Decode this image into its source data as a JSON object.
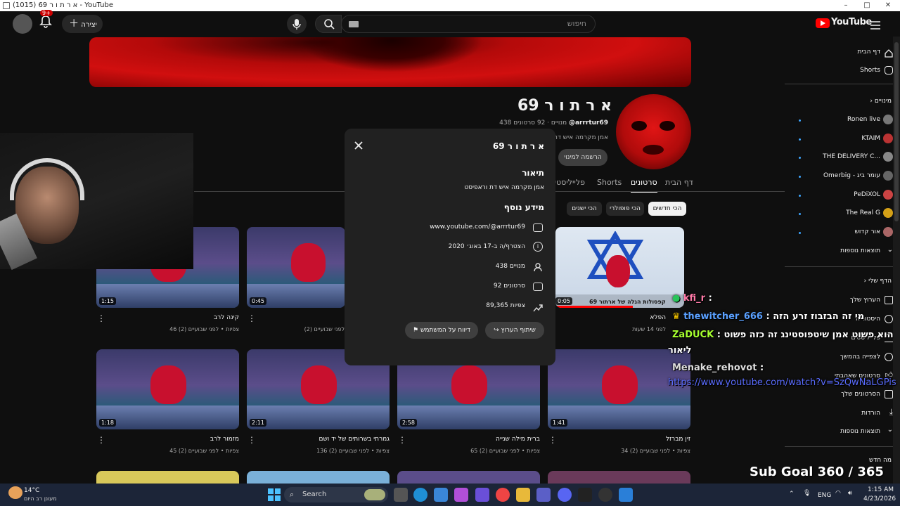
{
  "window": {
    "title": "(1015) א ר ת ו ר 69 - YouTube",
    "minimize": "–",
    "maximize": "□",
    "close": "✕"
  },
  "topbar": {
    "create_label": "יצירה",
    "notif_count": "9+",
    "search_placeholder": "חיפוש",
    "logo_text": "YouTube"
  },
  "channel": {
    "name": "א ר ת ו ר 69",
    "handle": "@arrrtur69",
    "meta": "438 מנויים · 92 סרטונים",
    "desc": "אמן מקרמה איש דת וראפיסט",
    "subscribe_label": "הרשמה למינוי"
  },
  "tabs": [
    "דף הבית",
    "סרטונים",
    "Shorts",
    "פלייליסטים"
  ],
  "chips": [
    "הכי חדשים",
    "הכי פופולרי",
    "הכי ישנים"
  ],
  "videos_row1": [
    {
      "dur": "1:15",
      "title": "קינה לרב",
      "meta": "46 צפיות • לפני שבועיים (2)"
    },
    {
      "dur": "0:45",
      "title": "",
      "meta": "לפני שבועיים (2)"
    },
    {
      "dur": "0:05",
      "title": "הפלא",
      "meta": "לפני 14 שעות",
      "overlay": "קפסולות הגלה של ארתור 69"
    }
  ],
  "videos_row2": [
    {
      "dur": "1:18",
      "title": "מזמור לרב",
      "meta": "45 צפיות • לפני שבועיים (2)"
    },
    {
      "dur": "2:11",
      "title": "גמרתי בשרותים של יד ושם",
      "meta": "136 צפיות • לפני שבועיים (2)"
    },
    {
      "dur": "2:58",
      "title": "ברית מילה שנייה",
      "meta": "65 צפיות • לפני שבועיים (2)"
    },
    {
      "dur": "1:41",
      "title": "זין מברזל",
      "meta": "34 צפיות • לפני שבועיים (2)"
    }
  ],
  "modal": {
    "title": "א ר ת ו ר 69",
    "about_heading": "תיאור",
    "about_text": "אמן מקרמה איש דת וראפיסט",
    "more_heading": "מידע נוסף",
    "url": "www.youtube.com/@arrrtur69",
    "joined": "הצטרף/ה ב-17 באוג׳ 2020",
    "subs": "438 מנויים",
    "videos": "92 סרטונים",
    "views": "89,365 צפיות",
    "share_label": "שיתוף הערוץ",
    "report_label": "דיווח על המשתמש"
  },
  "sidebar": {
    "home": "דף הבית",
    "shorts": "Shorts",
    "subs_heading": "מינויים",
    "subs": [
      "Ronen live",
      "KTAIM",
      "THE DELIVERY C...",
      "Omerbig - עומר ביג",
      "PeDiXOL",
      "The Real G",
      "אור קדוש"
    ],
    "show_more": "תוצאות נוספות",
    "you_heading": "הדף שלי",
    "you_items": [
      "הערוץ שלך",
      "היסטוריה",
      "פלייליסטים",
      "לצפייה בהמשך",
      "סרטונים שאהבתי",
      "הסרטונים שלך",
      "הורדות",
      "תוצאות נוספות"
    ],
    "new_heading": "מה חדש"
  },
  "chat": [
    {
      "user": "kfi_r",
      "sep": " :",
      "msg": "",
      "color": "#ff7aa8"
    },
    {
      "user": "thewitcher_666",
      "sep": " : ",
      "msg": "מי זה הבזבוז זרע הזה",
      "color": "#5aa0ff"
    },
    {
      "user": "ZaDUCK",
      "sep": " : ",
      "msg": "הוא פשוט אמן שיטפוסטינג זה כזה פשוט",
      "color": "#a6ff2f"
    },
    {
      "user": "",
      "sep": "",
      "msg": "ליאור",
      "color": "#ffffff"
    },
    {
      "user": "Menake_rehovot",
      "sep": " :",
      "msg": "",
      "color": "#dddddd"
    },
    {
      "user": "",
      "sep": "",
      "msg": "https://www.youtube.com/watch?v=SzQwNaLGPis",
      "color": "#5a6cff"
    }
  ],
  "subgoal": "Sub Goal 360 / 365",
  "taskbar": {
    "weather_temp": "14°C",
    "weather_desc": "מעונן רב היום",
    "search_label": "Search",
    "lang": "ENG",
    "time": "1:15 AM",
    "date": "4/23/2026"
  }
}
